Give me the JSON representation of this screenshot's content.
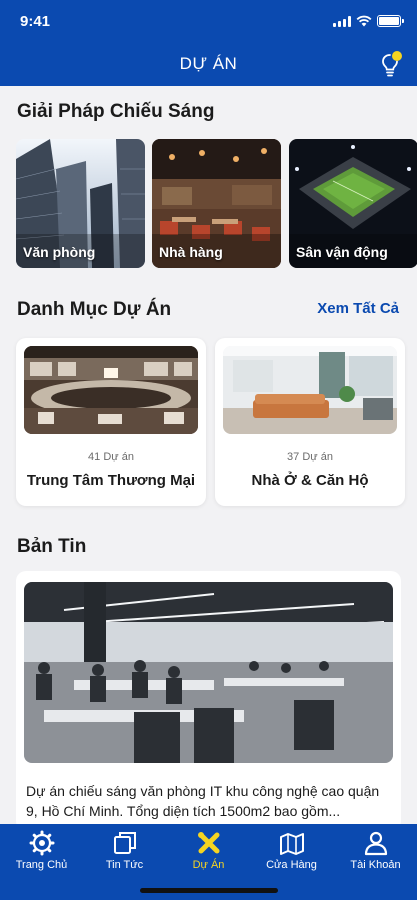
{
  "status_bar": {
    "time": "9:41"
  },
  "header": {
    "title": "DỰ ÁN",
    "bulb_icon": "lightbulb-icon"
  },
  "solutions": {
    "title": "Giải Pháp Chiếu Sáng",
    "items": [
      {
        "label": "Văn phòng"
      },
      {
        "label": "Nhà hàng"
      },
      {
        "label": "Sân vận động"
      }
    ]
  },
  "categories": {
    "title": "Danh Mục Dự Án",
    "see_all": "Xem Tất Cả",
    "items": [
      {
        "count": "41 Dự án",
        "name": "Trung Tâm Thương Mại"
      },
      {
        "count": "37 Dự án",
        "name": "Nhà Ở & Căn Hộ"
      }
    ]
  },
  "news": {
    "title": "Bản Tin",
    "items": [
      {
        "description": "Dự án chiếu sáng văn phòng IT khu công nghệ cao quận 9, Hồ Chí Minh. Tổng diện tích 1500m2 bao gồm..."
      }
    ]
  },
  "tabbar": {
    "active_color": "#f5d421",
    "items": [
      {
        "label": "Trang Chủ",
        "icon": "gear-home-icon"
      },
      {
        "label": "Tin Tức",
        "icon": "news-icon"
      },
      {
        "label": "Dự Án",
        "icon": "project-icon"
      },
      {
        "label": "Cửa Hàng",
        "icon": "store-map-icon"
      },
      {
        "label": "Tài Khoản",
        "icon": "user-icon"
      }
    ]
  },
  "colors": {
    "brand": "#0b4ab0",
    "accent": "#f5d421",
    "background": "#f2f2f4"
  }
}
